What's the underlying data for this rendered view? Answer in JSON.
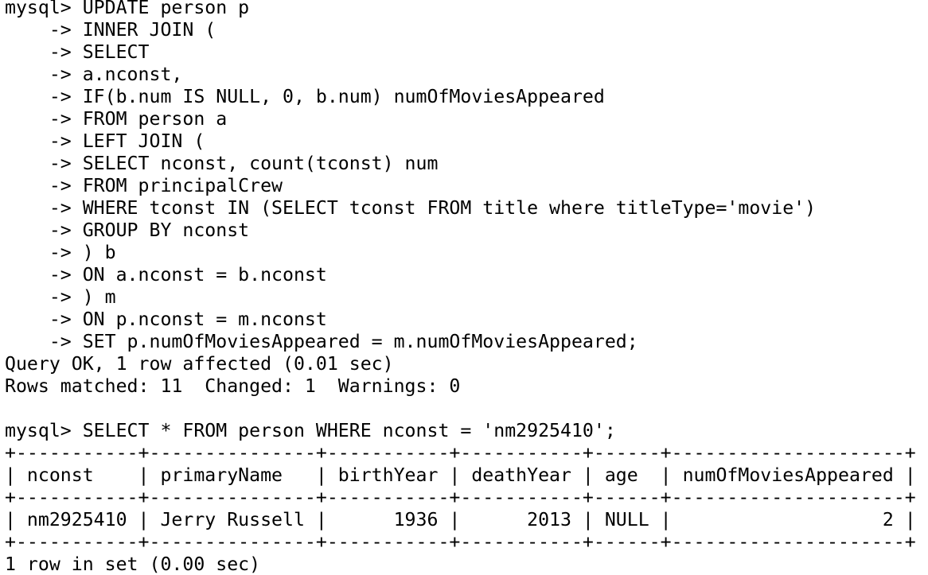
{
  "terminal": {
    "lines": [
      "mysql> UPDATE person p",
      "    -> INNER JOIN (",
      "    -> SELECT",
      "    -> a.nconst,",
      "    -> IF(b.num IS NULL, 0, b.num) numOfMoviesAppeared",
      "    -> FROM person a",
      "    -> LEFT JOIN (",
      "    -> SELECT nconst, count(tconst) num",
      "    -> FROM principalCrew",
      "    -> WHERE tconst IN (SELECT tconst FROM title where titleType='movie')",
      "    -> GROUP BY nconst",
      "    -> ) b",
      "    -> ON a.nconst = b.nconst",
      "    -> ) m",
      "    -> ON p.nconst = m.nconst",
      "    -> SET p.numOfMoviesAppeared = m.numOfMoviesAppeared;",
      "Query OK, 1 row affected (0.01 sec)",
      "Rows matched: 11  Changed: 1  Warnings: 0",
      "",
      "mysql> SELECT * FROM person WHERE nconst = 'nm2925410';",
      "+-----------+---------------+-----------+-----------+------+---------------------+",
      "| nconst    | primaryName   | birthYear | deathYear | age  | numOfMoviesAppeared |",
      "+-----------+---------------+-----------+-----------+------+---------------------+",
      "| nm2925410 | Jerry Russell |      1936 |      2013 | NULL |                   2 |",
      "+-----------+---------------+-----------+-----------+------+---------------------+",
      "1 row in set (0.00 sec)"
    ]
  }
}
